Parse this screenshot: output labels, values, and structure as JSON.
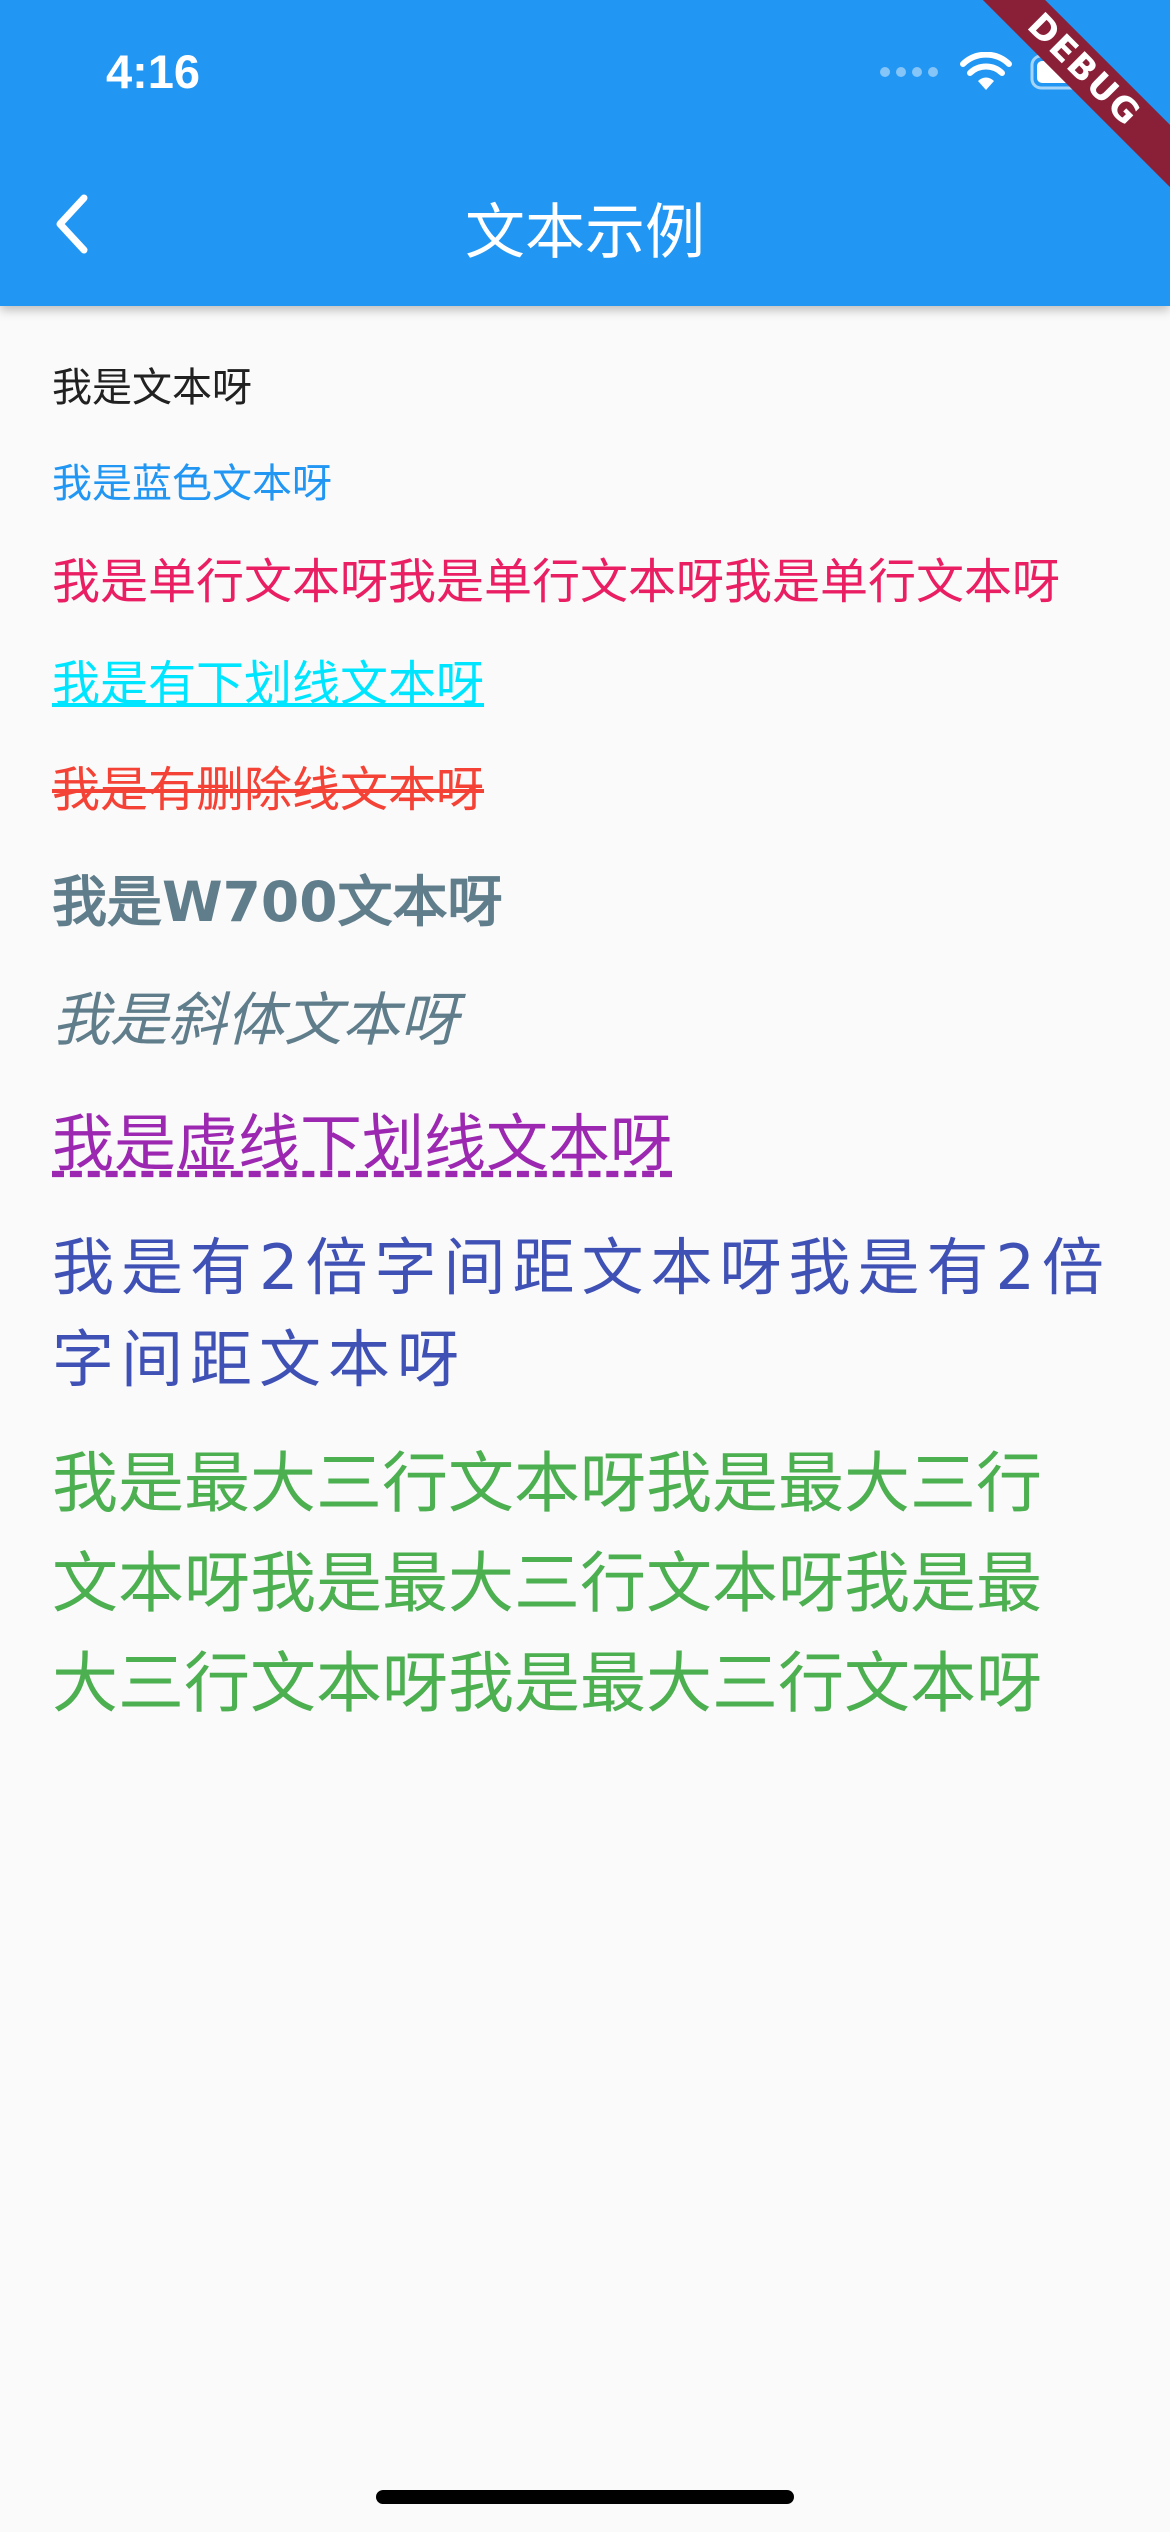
{
  "status_bar": {
    "time": "4:16"
  },
  "appbar": {
    "title": "文本示例",
    "background": "#2196f3",
    "back_icon": "chevron-left-icon"
  },
  "debug_banner": {
    "label": "DEBUG",
    "color": "#8a2038"
  },
  "texts": [
    {
      "text": "我是文本呀",
      "color": "#212121"
    },
    {
      "text": "我是蓝色文本呀",
      "color": "#2196f3"
    },
    {
      "text": "我是单行文本呀我是单行文本呀我是单行文本呀",
      "color": "#e91e63"
    },
    {
      "text": "我是有下划线文本呀",
      "color": "#00e5ff"
    },
    {
      "text": "我是有删除线文本呀",
      "color": "#f44336"
    },
    {
      "text": "我是W700文本呀",
      "color": "#607d8b"
    },
    {
      "text": "我是斜体文本呀",
      "color": "#607d8b"
    },
    {
      "text": "我是虚线下划线文本呀",
      "color": "#9c27b0"
    },
    {
      "text": "我是有2倍字间距文本呀我是有2倍字间距文本呀",
      "color": "#3f51b5"
    },
    {
      "text": "我是最大三行文本呀我是最大三行文本呀我是最大三行文本呀我是最大三行文本呀我是最大三行文本呀",
      "color": "#4caf50"
    }
  ]
}
